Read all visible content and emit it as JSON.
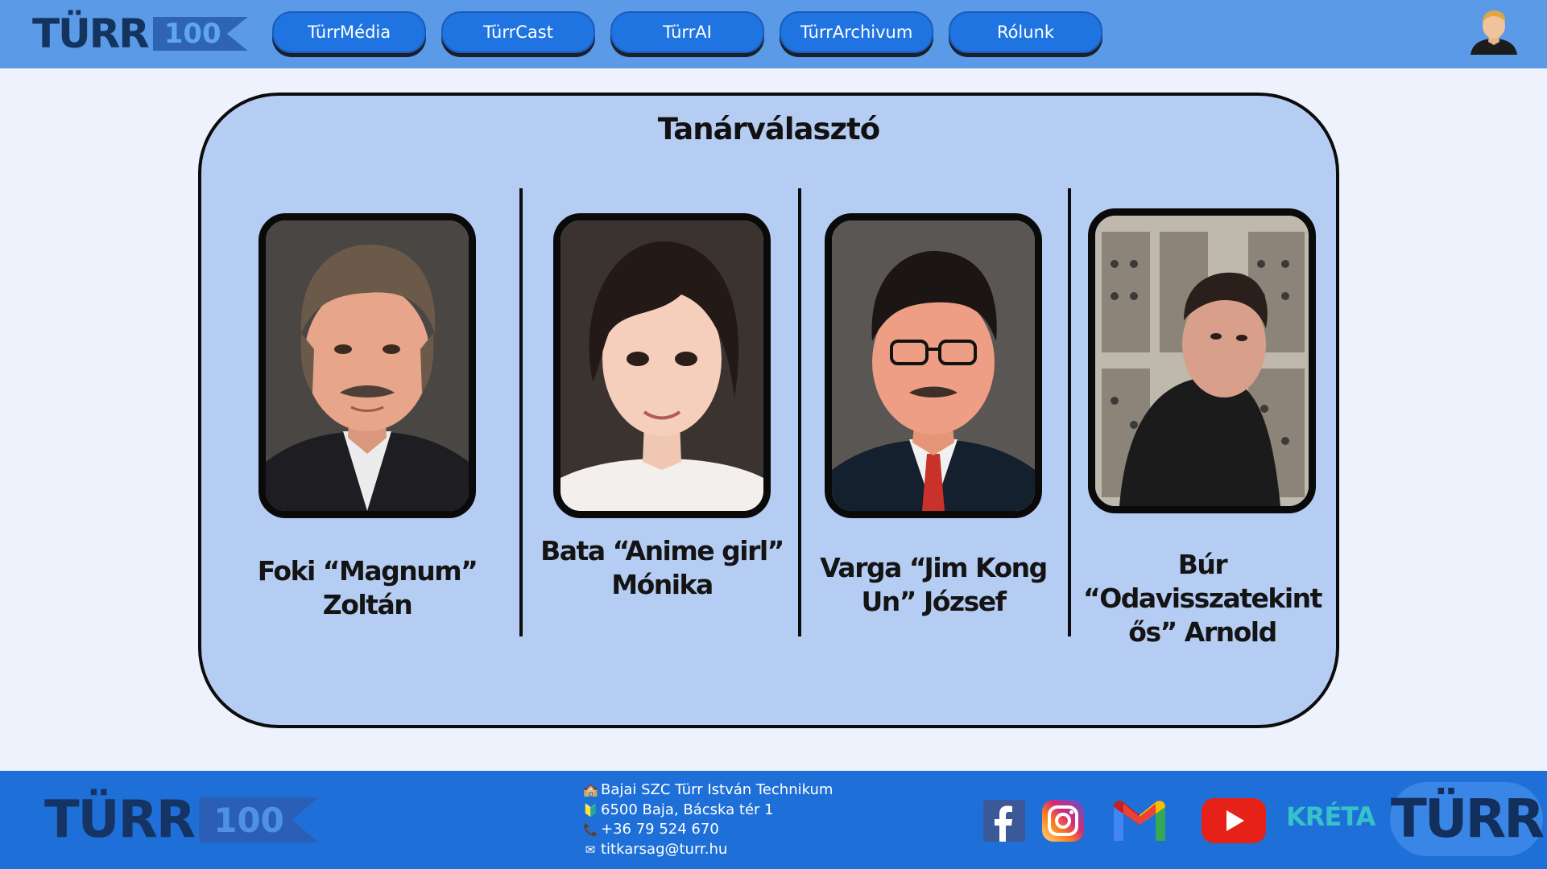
{
  "header": {
    "logo_text": "TÜRR",
    "logo_badge": "100",
    "nav": [
      {
        "label": "TürrMédia"
      },
      {
        "label": "TürrCast"
      },
      {
        "label": "TürrAI"
      },
      {
        "label": "TürrArchivum"
      },
      {
        "label": "Rólunk"
      }
    ],
    "user_icon": "user-avatar-icon"
  },
  "panel": {
    "title": "Tanárválasztó",
    "teachers": [
      {
        "name_line1": "Foki “Magnum”",
        "name_line2": "Zoltán",
        "name_line3": ""
      },
      {
        "name_line1": "Bata “Anime girl”",
        "name_line2": "Mónika",
        "name_line3": ""
      },
      {
        "name_line1": "Varga “Jim Kong",
        "name_line2": "Un” József",
        "name_line3": ""
      },
      {
        "name_line1": "Búr",
        "name_line2": "“Odavisszatekint",
        "name_line3": "ős” Arnold"
      }
    ]
  },
  "footer": {
    "logo_text": "TÜRR",
    "logo_badge": "100",
    "contact": {
      "school": "Bajai SZC Türr István Technikum",
      "address": "6500 Baja, Bácska tér 1",
      "phone": "+36 79 524 670",
      "email": "titkarsag@turr.hu"
    },
    "social": {
      "facebook": "f",
      "youtube": "▶",
      "kreta": "KRÉTA"
    },
    "badge_text": "TÜRR"
  },
  "colors": {
    "header_bg": "#5a9ae6",
    "nav_button": "#1f74e1",
    "panel_bg": "#b6cdf3",
    "footer_bg": "#1e6fd8",
    "page_bg": "#eef2fd"
  }
}
